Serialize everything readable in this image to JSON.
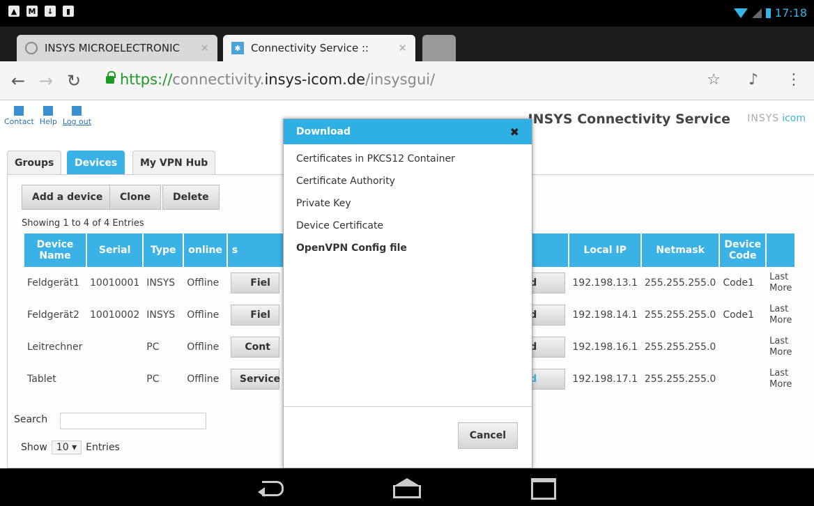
{
  "status": {
    "time": "17:18"
  },
  "browser": {
    "tabs": [
      {
        "label": "INSYS MICROELECTRONIC"
      },
      {
        "label": "Connectivity Service ::"
      }
    ],
    "url": {
      "scheme": "https://",
      "pre": "connectivity.",
      "domain": "insys-icom.de",
      "path": "/insysgui/"
    }
  },
  "page": {
    "toplinks": {
      "contact": "Contact",
      "help": "Help",
      "logout": "Log out"
    },
    "title": "INSYS Connectivity Service",
    "logo": {
      "a": "INSYS",
      "b": "icom"
    },
    "tabs": {
      "groups": "Groups",
      "devices": "Devices",
      "vpn_hub": "My VPN Hub"
    },
    "buttons": {
      "add": "Add a device",
      "clone": "Clone",
      "delete": "Delete"
    },
    "showing": "Showing 1 to 4 of 4 Entries",
    "table": {
      "headers": [
        "Device Name",
        "Serial",
        "Type",
        "online",
        "s",
        "Local IP",
        "Netmask",
        "Device Code"
      ],
      "rows": [
        {
          "name": "Feldgerät1",
          "serial": "10010001",
          "type": "INSYS",
          "online": "Offline",
          "btn": "Fiel",
          "dl": "load",
          "ip": "192.198.13.1",
          "mask": "255.255.255.0",
          "code": "Code1",
          "last1": "Last",
          "last2": "More"
        },
        {
          "name": "Feldgerät2",
          "serial": "10010002",
          "type": "INSYS",
          "online": "Offline",
          "btn": "Fiel",
          "dl": "load",
          "ip": "192.198.14.1",
          "mask": "255.255.255.0",
          "code": "Code1",
          "last1": "Last",
          "last2": "More"
        },
        {
          "name": "Leitrechner",
          "serial": "",
          "type": "PC",
          "online": "Offline",
          "btn": "Cont",
          "dl": "load",
          "ip": "192.198.16.1",
          "mask": "255.255.255.0",
          "code": "",
          "last1": "Last",
          "last2": "More"
        },
        {
          "name": "Tablet",
          "serial": "",
          "type": "PC",
          "online": "Offline",
          "btn": "Service",
          "dl": "load",
          "ip": "192.198.17.1",
          "mask": "255.255.255.0",
          "code": "",
          "last1": "Last",
          "last2": "More"
        }
      ]
    },
    "search_label": "Search",
    "entries": {
      "show": "Show",
      "value": "10",
      "suffix": "Entries"
    }
  },
  "dialog": {
    "title": "Download",
    "items": [
      "Certificates in PKCS12 Container",
      "Certificate Authority",
      "Private Key",
      "Device Certificate",
      "OpenVPN Config file"
    ],
    "cancel": "Cancel"
  },
  "colors": {
    "accent": "#3ab2e6",
    "https_green": "#1e9a22"
  }
}
